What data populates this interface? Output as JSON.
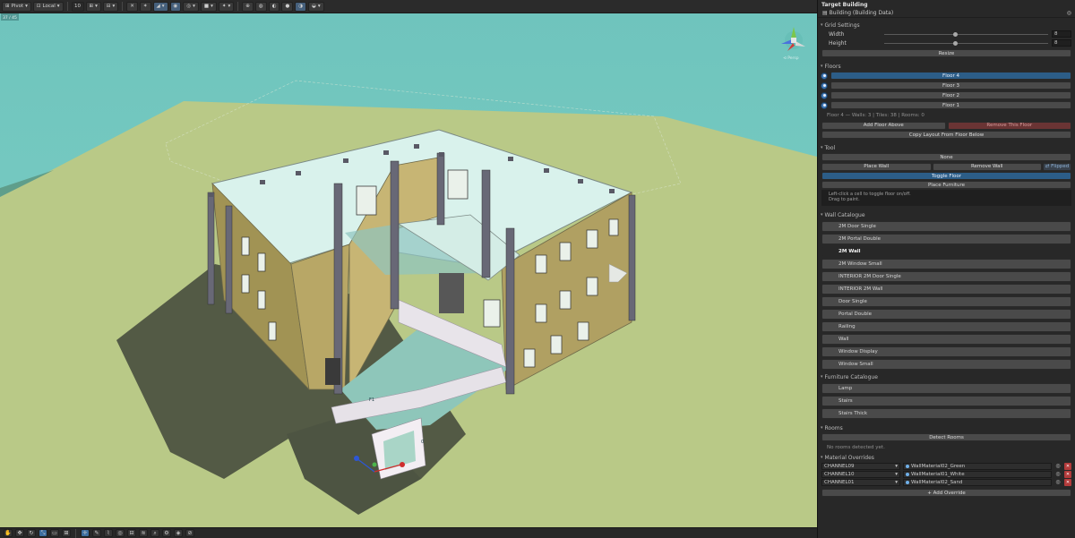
{
  "toolbar": {
    "pivot": "Pivot",
    "local": "Local",
    "snap_value": "10"
  },
  "viewport": {
    "persp_label": "⊲ Persp",
    "stats_label": "37 / 45",
    "cell_label_1": "0",
    "cell_label_2": "F1"
  },
  "inspector": {
    "title": "Target Building",
    "component": "Building (Building Data)",
    "grid_settings": {
      "title": "Grid Settings",
      "width_label": "Width",
      "width_value": "8",
      "height_label": "Height",
      "height_value": "8",
      "resize": "Resize"
    },
    "floors": {
      "title": "Floors",
      "items": [
        "Floor 4",
        "Floor 3",
        "Floor 2",
        "Floor 1"
      ],
      "selected": 0,
      "info": "Floor 4  —  Walls: 3  |  Tiles: 38  |  Rooms: 0",
      "add_floor": "Add Floor Above",
      "remove_floor": "Remove This Floor",
      "copy_layout": "Copy Layout From Floor Below"
    },
    "tool": {
      "title": "Tool",
      "none": "None",
      "place_wall": "Place Wall",
      "remove_wall": "Remove Wall",
      "flipped": "⇄ Flipped",
      "toggle_floor": "Toggle Floor",
      "place_furniture": "Place Furniture",
      "hint_line1": "Left-click a cell to toggle floor on/off.",
      "hint_line2": "Drag to paint."
    },
    "wall_catalogue": {
      "title": "Wall Catalogue",
      "items": [
        "2M Door Single",
        "2M Portal Double",
        "2M Wall",
        "2M Window Small",
        "INTERIOR 2M Door Single",
        "INTERIOR 2M Wall",
        "Door Single",
        "Portal Double",
        "Railing",
        "Wall",
        "Window Display",
        "Window Small"
      ],
      "active": 2
    },
    "furniture_catalogue": {
      "title": "Furniture Catalogue",
      "items": [
        "Lamp",
        "Stairs",
        "Stairs Thick"
      ]
    },
    "rooms": {
      "title": "Rooms",
      "detect": "Detect Rooms",
      "empty": "No rooms detected yet."
    },
    "material_overrides": {
      "title": "Material Overrides",
      "rows": [
        {
          "channel": "CHANNEL09",
          "material": "WallMaterial02_Green"
        },
        {
          "channel": "CHANNEL10",
          "material": "WallMaterial01_White"
        },
        {
          "channel": "CHANNEL01",
          "material": "WallMaterial02_Sand"
        }
      ],
      "add": "+ Add Override"
    }
  },
  "colors": {
    "sky": "#6ec6be",
    "ground": "#b7c785",
    "accent": "#2c5d87",
    "danger": "#6a3434"
  }
}
